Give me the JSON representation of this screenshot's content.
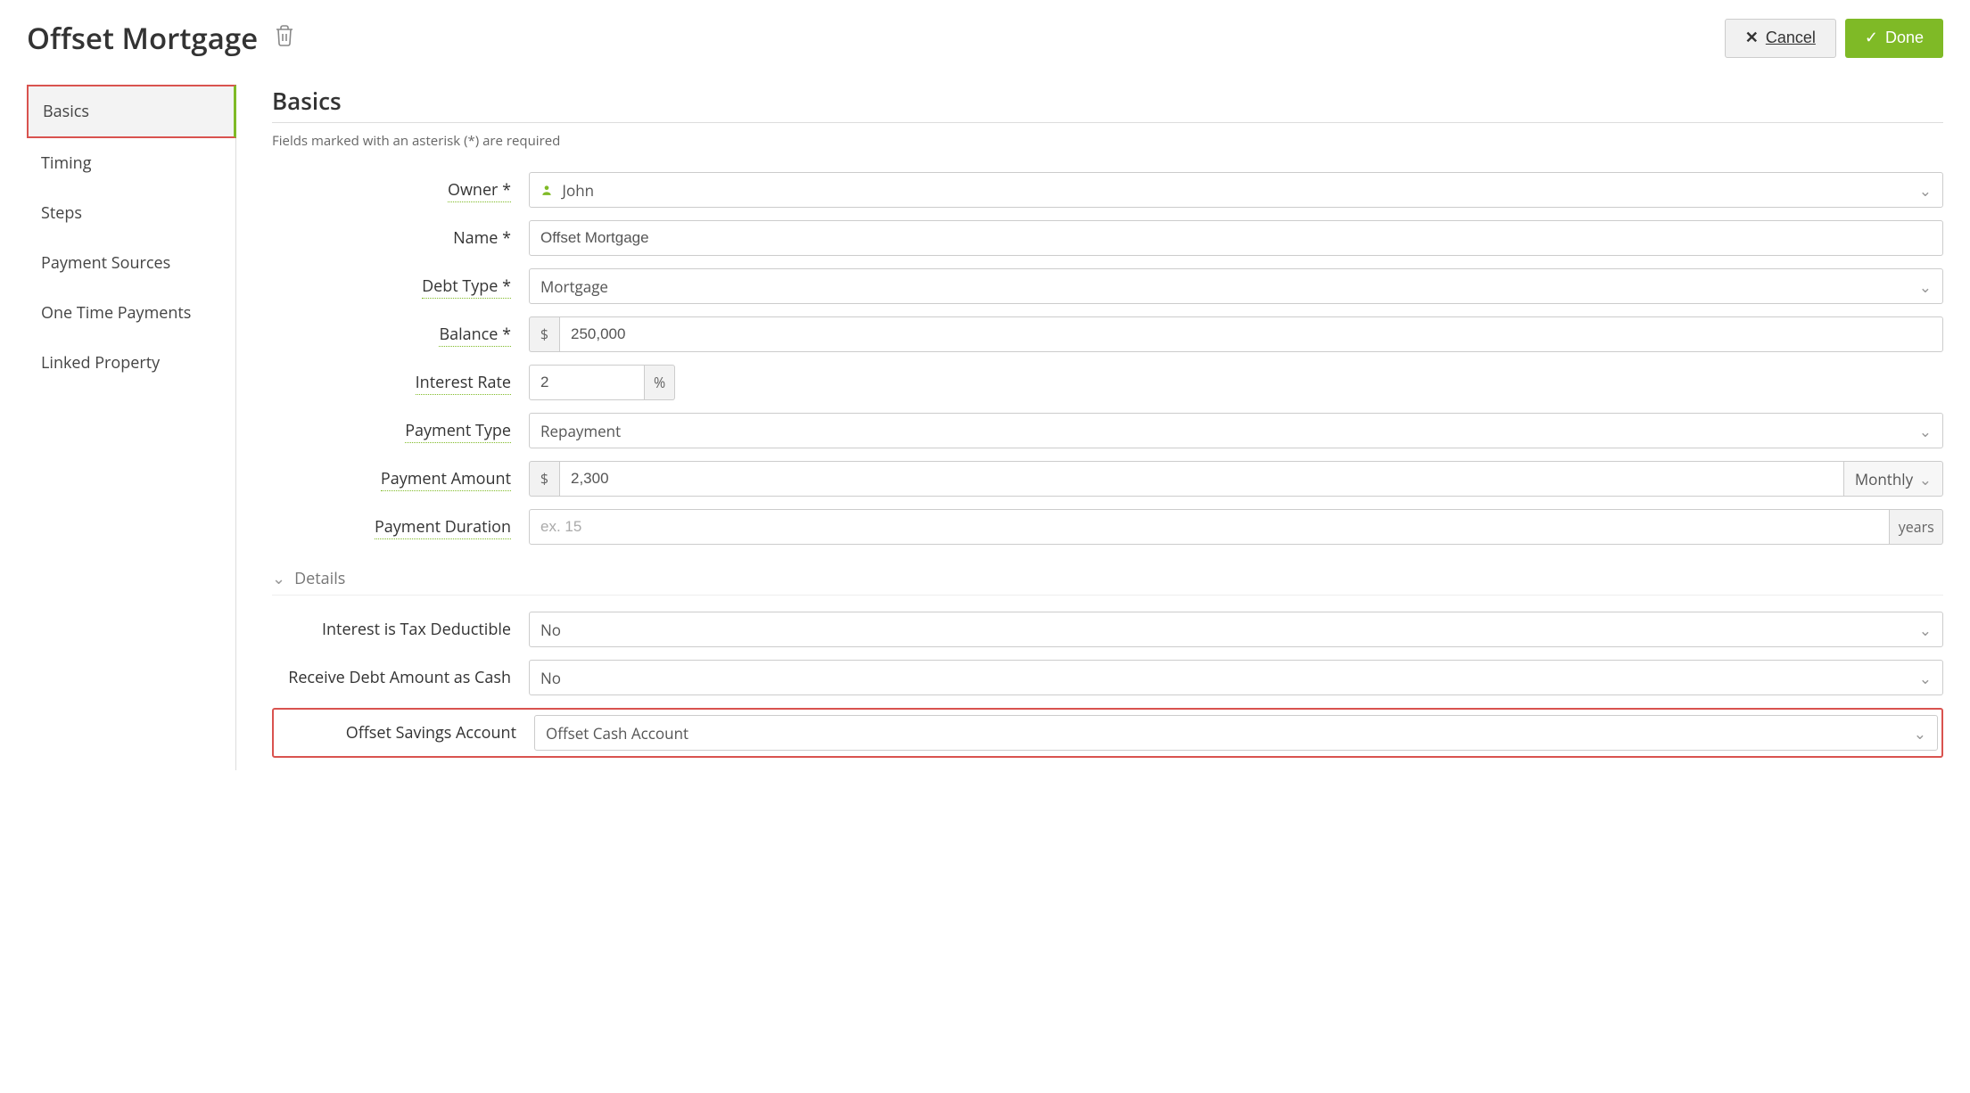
{
  "header": {
    "title": "Offset Mortgage",
    "cancel_label": "Cancel",
    "done_label": "Done"
  },
  "sidebar": {
    "items": [
      {
        "label": "Basics",
        "active": true
      },
      {
        "label": "Timing",
        "active": false
      },
      {
        "label": "Steps",
        "active": false
      },
      {
        "label": "Payment Sources",
        "active": false
      },
      {
        "label": "One Time Payments",
        "active": false
      },
      {
        "label": "Linked Property",
        "active": false
      }
    ]
  },
  "section": {
    "title": "Basics",
    "helper": "Fields marked with an asterisk (*) are required",
    "details_label": "Details"
  },
  "form": {
    "owner": {
      "label": "Owner *",
      "value": "John"
    },
    "name": {
      "label": "Name *",
      "value": "Offset Mortgage"
    },
    "debt_type": {
      "label": "Debt Type *",
      "value": "Mortgage"
    },
    "balance": {
      "label": "Balance *",
      "prefix": "$",
      "value": "250,000"
    },
    "interest_rate": {
      "label": "Interest Rate",
      "value": "2",
      "suffix": "%"
    },
    "payment_type": {
      "label": "Payment Type",
      "value": "Repayment"
    },
    "payment_amount": {
      "label": "Payment Amount",
      "prefix": "$",
      "value": "2,300",
      "frequency": "Monthly"
    },
    "payment_duration": {
      "label": "Payment Duration",
      "placeholder": "ex. 15",
      "value": "",
      "suffix": "years"
    },
    "interest_tax_deductible": {
      "label": "Interest is Tax Deductible",
      "value": "No"
    },
    "receive_debt_cash": {
      "label": "Receive Debt Amount as Cash",
      "value": "No"
    },
    "offset_savings": {
      "label": "Offset Savings Account",
      "value": "Offset Cash Account"
    }
  }
}
